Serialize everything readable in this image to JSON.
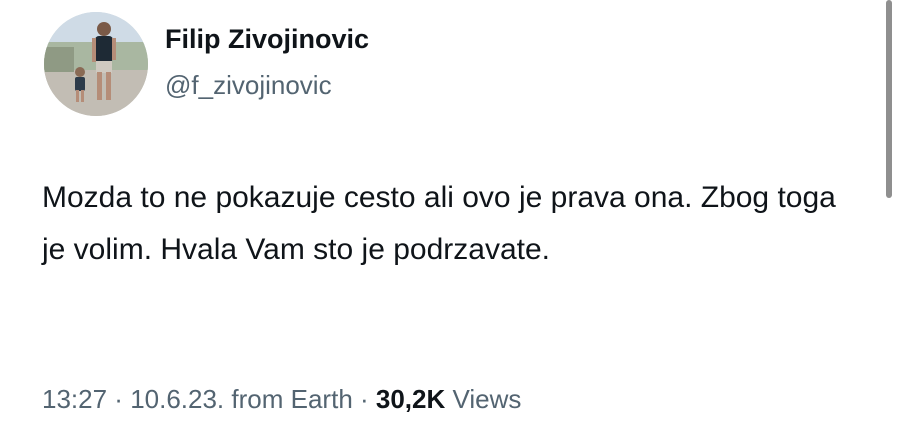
{
  "author": {
    "display_name": "Filip Zivojinovic",
    "handle": "@f_zivojinovic"
  },
  "tweet": {
    "text": "Mozda to ne pokazuje cesto ali ovo je prava ona. Zbog toga je volim. Hvala Vam sto je podrzavate.",
    "time": "13:27",
    "separator": " · ",
    "date": "10.6.23.",
    "source": "from Earth",
    "views_count": "30,2K",
    "views_label": "Views"
  },
  "icons": {
    "more": "more-horizontal-icon"
  }
}
